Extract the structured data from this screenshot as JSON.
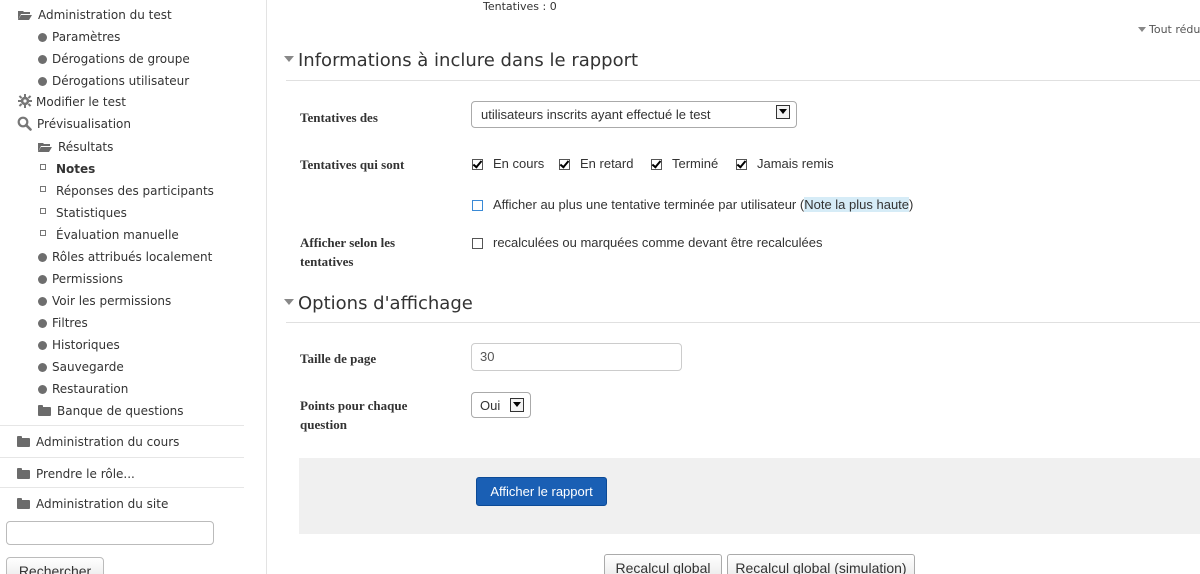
{
  "sidebar": {
    "items": [
      {
        "label": "Administration du test",
        "icon": "folder-open-icon"
      },
      {
        "label": "Paramètres",
        "icon": "dot-icon"
      },
      {
        "label": "Dérogations de groupe",
        "icon": "dot-icon"
      },
      {
        "label": "Dérogations utilisateur",
        "icon": "dot-icon"
      },
      {
        "label": "Modifier le test",
        "icon": "gear-icon"
      },
      {
        "label": "Prévisualisation",
        "icon": "search-icon"
      },
      {
        "label": "Résultats",
        "icon": "folder-open-icon"
      },
      {
        "label": "Notes",
        "icon": "square-bullet-icon"
      },
      {
        "label": "Réponses des participants",
        "icon": "square-bullet-icon"
      },
      {
        "label": "Statistiques",
        "icon": "square-bullet-icon"
      },
      {
        "label": "Évaluation manuelle",
        "icon": "square-bullet-icon"
      },
      {
        "label": "Rôles attribués localement",
        "icon": "dot-icon"
      },
      {
        "label": "Permissions",
        "icon": "dot-icon"
      },
      {
        "label": "Voir les permissions",
        "icon": "dot-icon"
      },
      {
        "label": "Filtres",
        "icon": "dot-icon"
      },
      {
        "label": "Historiques",
        "icon": "dot-icon"
      },
      {
        "label": "Sauvegarde",
        "icon": "dot-icon"
      },
      {
        "label": "Restauration",
        "icon": "dot-icon"
      },
      {
        "label": "Banque de questions",
        "icon": "folder-icon"
      },
      {
        "label": "Administration du cours",
        "icon": "folder-icon"
      },
      {
        "label": "Prendre le rôle...",
        "icon": "folder-icon"
      },
      {
        "label": "Administration du site",
        "icon": "folder-icon"
      }
    ],
    "search_button": "Rechercher"
  },
  "main": {
    "attempts_info": "Tentatives : 0",
    "collapse_all": "Tout rédu",
    "section1": {
      "title": "Informations à inclure dans le rapport",
      "attempts_from_label": "Tentatives des",
      "attempts_from_value": "utilisateurs inscrits ayant effectué le test",
      "attempts_state_label": "Tentatives qui sont",
      "states": [
        "En cours",
        "En retard",
        "Terminé",
        "Jamais remis"
      ],
      "one_attempt_text": "Afficher au plus une tentative terminée par utilisateur (",
      "one_attempt_highlight": "Note la plus haute",
      "one_attempt_close": ")",
      "show_by_label": "Afficher selon les tentatives",
      "show_by_option": "recalculées ou marquées comme devant être recalculées"
    },
    "section2": {
      "title": "Options d'affichage",
      "page_size_label": "Taille de page",
      "page_size_value": "30",
      "marks_label": "Points pour chaque question",
      "marks_value": "Oui"
    },
    "submit_button": "Afficher le rapport",
    "regrade_all": "Recalcul global",
    "regrade_dry_run": "Recalcul global (simulation)"
  }
}
